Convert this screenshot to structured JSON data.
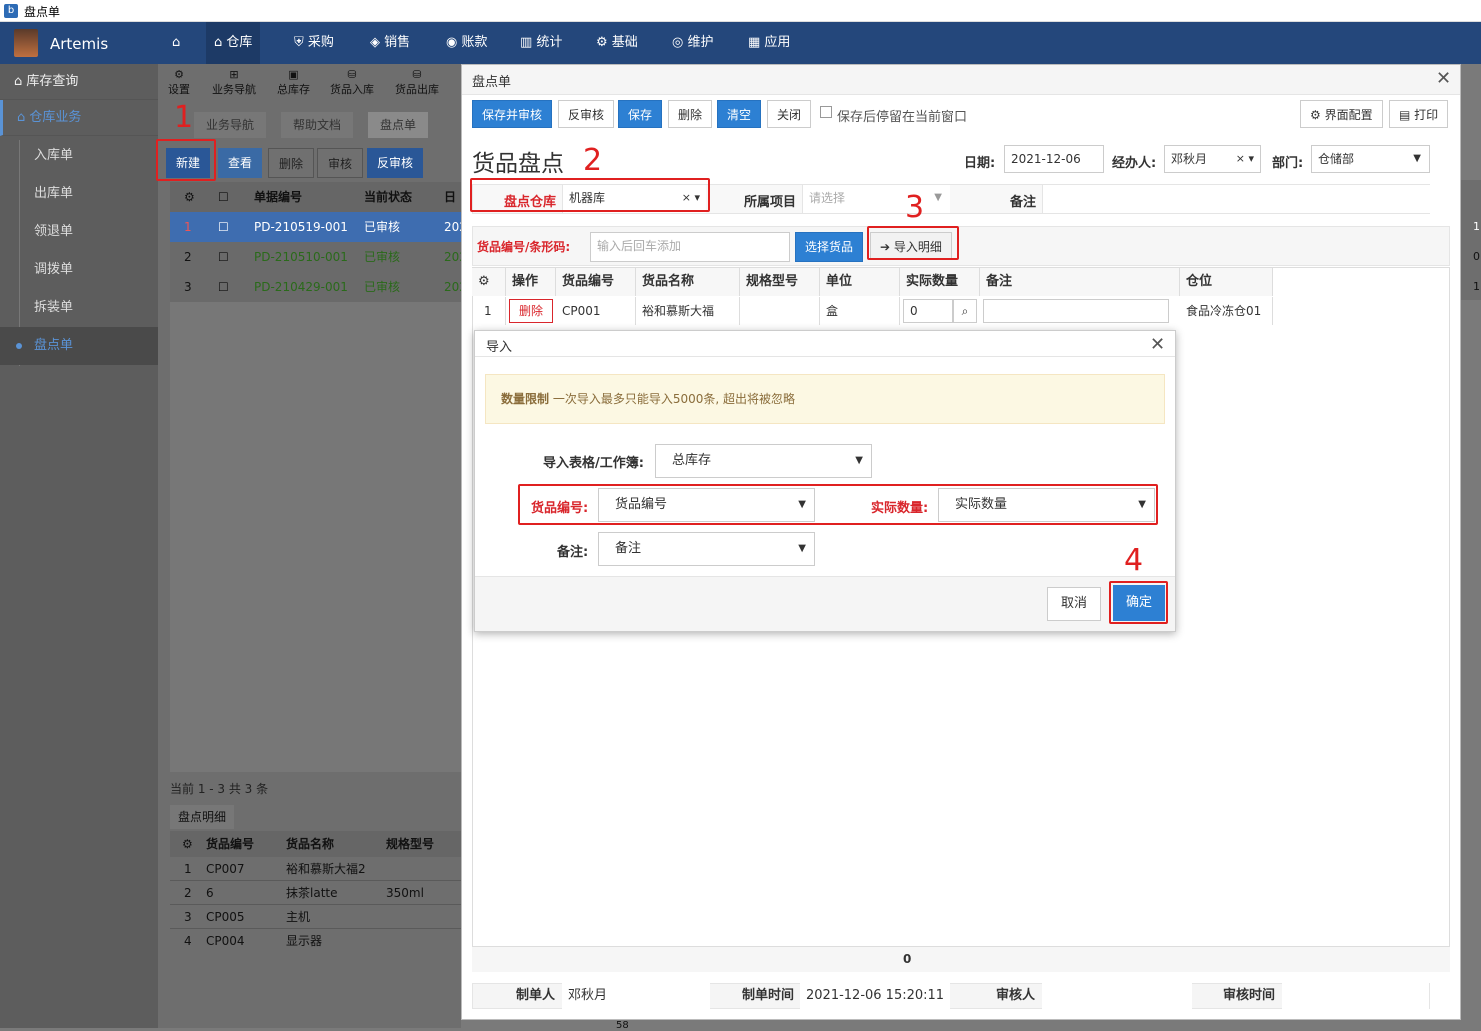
{
  "window_title": "盘点单",
  "app_name": "Artemis",
  "nav": [
    "仓库",
    "采购",
    "销售",
    "账款",
    "统计",
    "基础",
    "维护",
    "应用"
  ],
  "sidebar": {
    "items": [
      {
        "label": "库存查询"
      },
      {
        "label": "仓库业务"
      }
    ],
    "subitems": [
      "入库单",
      "出库单",
      "领退单",
      "调拨单",
      "拆装单",
      "盘点单"
    ]
  },
  "toolbar": [
    "设置",
    "业务导航",
    "总库存",
    "货品入库",
    "货品出库"
  ],
  "bg_tabs": [
    "业务导航",
    "帮助文档",
    "盘点单"
  ],
  "bg_buttons": [
    "新建",
    "查看",
    "删除",
    "审核",
    "反审核"
  ],
  "bg_grid": {
    "headers": [
      "单据编号",
      "当前状态",
      "日"
    ],
    "rows": [
      [
        "1",
        "PD-210519-001",
        "已审核",
        "202"
      ],
      [
        "2",
        "PD-210510-001",
        "已审核",
        "202"
      ],
      [
        "3",
        "PD-210429-001",
        "已审核",
        "202"
      ]
    ]
  },
  "pager": "当前 1 - 3 共 3 条",
  "detail": {
    "tab": "盘点明细",
    "headers": [
      "货品编号",
      "货品名称",
      "规格型号"
    ],
    "rows": [
      [
        "1",
        "CP007",
        "裕和慕斯大福2",
        ""
      ],
      [
        "2",
        "6",
        "抹茶latte",
        "350ml"
      ],
      [
        "3",
        "CP005",
        "主机",
        ""
      ],
      [
        "4",
        "CP004",
        "显示器",
        ""
      ]
    ]
  },
  "win": {
    "title": "盘点单",
    "buttons": [
      "保存并审核",
      "反审核",
      "保存",
      "删除",
      "清空",
      "关闭"
    ],
    "stay_label": "保存后停留在当前窗口",
    "config_btn": "界面配置",
    "print_btn": "打印",
    "heading": "货品盘点",
    "date_label": "日期:",
    "date_value": "2021-12-06",
    "handler_label": "经办人:",
    "handler_value": "邓秋月",
    "dept_label": "部门:",
    "dept_value": "仓储部",
    "warehouse_label": "盘点仓库",
    "warehouse_value": "机器库",
    "project_label": "所属项目",
    "project_placeholder": "请选择",
    "remark_label": "备注",
    "barcode_label": "货品编号/条形码:",
    "barcode_placeholder": "输入后回车添加",
    "choose_btn": "选择货品",
    "import_btn": "导入明细",
    "grid_headers": [
      "操作",
      "货品编号",
      "货品名称",
      "规格型号",
      "单位",
      "实际数量",
      "备注",
      "仓位"
    ],
    "row": {
      "no": "1",
      "del": "删除",
      "code": "CP001",
      "name": "裕和慕斯大福",
      "spec": "",
      "unit": "盒",
      "qty": "0",
      "remark": "",
      "loc": "食品冷冻仓01"
    },
    "total_qty": "0",
    "footer": {
      "creator_label": "制单人",
      "creator": "邓秋月",
      "ctime_label": "制单时间",
      "ctime": "2021-12-06 15:20:11",
      "auditor_label": "审核人",
      "atime_label": "审核时间"
    },
    "right_edge": [
      "1",
      "0",
      "1"
    ]
  },
  "modal": {
    "title": "导入",
    "warn_title": "数量限制",
    "warn_text": "一次导入最多只能导入5000条, 超出将被忽略",
    "sheet_label": "导入表格/工作簿:",
    "sheet_value": "总库存",
    "code_label": "货品编号:",
    "code_value": "货品编号",
    "qty_label": "实际数量:",
    "qty_value": "实际数量",
    "remark_label": "备注:",
    "remark_value": "备注",
    "cancel": "取消",
    "ok": "确定"
  },
  "annotations": [
    "1",
    "2",
    "3",
    "4"
  ],
  "bottom_num": "58"
}
